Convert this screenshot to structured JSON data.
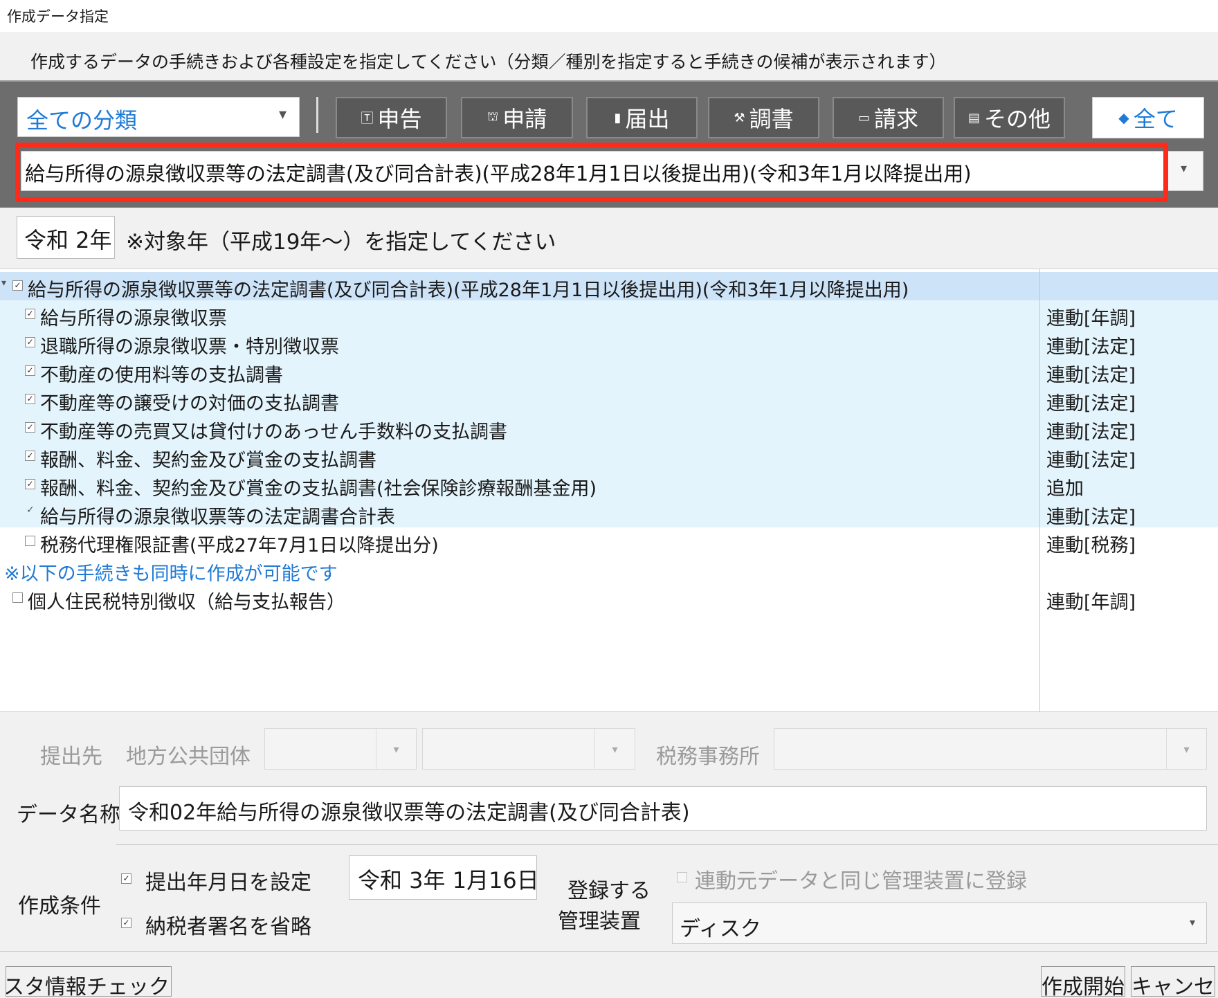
{
  "window": {
    "title": "作成データ指定"
  },
  "instruction": "作成するデータの手続きおよび各種設定を指定してください（分類／種別を指定すると手続きの候補が表示されます）",
  "toolbar": {
    "category_select": "全ての分類",
    "filters": [
      {
        "label": "申告",
        "icon": "tax-icon"
      },
      {
        "label": "申請",
        "icon": "stamp-icon"
      },
      {
        "label": "届出",
        "icon": "mailbox-icon"
      },
      {
        "label": "調書",
        "icon": "gavel-icon"
      },
      {
        "label": "請求",
        "icon": "money-icon"
      },
      {
        "label": "その他",
        "icon": "document-icon"
      }
    ],
    "all_button": {
      "label": "全て",
      "icon": "layers-icon"
    },
    "procedure_select": "給与所得の源泉徴収票等の法定調書(及び同合計表)(平成28年1月1日以後提出用)(令和3年1月以降提出用)"
  },
  "year": {
    "value": "令和 2年",
    "note": "※対象年（平成19年～）を指定してください"
  },
  "tree": {
    "root": {
      "label": "給与所得の源泉徴収票等の法定調書(及び同合計表)(平成28年1月1日以後提出用)(令和3年1月以降提出用)",
      "checked": true
    },
    "children": [
      {
        "label": "給与所得の源泉徴収票",
        "status": "連動[年調]",
        "checked": true
      },
      {
        "label": "退職所得の源泉徴収票・特別徴収票",
        "status": "連動[法定]",
        "checked": true
      },
      {
        "label": "不動産の使用料等の支払調書",
        "status": "連動[法定]",
        "checked": true
      },
      {
        "label": "不動産等の譲受けの対価の支払調書",
        "status": "連動[法定]",
        "checked": true
      },
      {
        "label": "不動産等の売買又は貸付けのあっせん手数料の支払調書",
        "status": "連動[法定]",
        "checked": true
      },
      {
        "label": "報酬、料金、契約金及び賞金の支払調書",
        "status": "連動[法定]",
        "checked": true
      },
      {
        "label": "報酬、料金、契約金及び賞金の支払調書(社会保険診療報酬基金用)",
        "status": "追加",
        "checked": true
      },
      {
        "label": "給与所得の源泉徴収票等の法定調書合計表",
        "status": "連動[法定]",
        "checked": true
      },
      {
        "label": "税務代理権限証書(平成27年7月1日以降提出分)",
        "status": "連動[税務]",
        "checked": false
      }
    ],
    "also_note": "※以下の手続きも同時に作成が可能です",
    "extra": {
      "label": "個人住民税特別徴収（給与支払報告）",
      "status": "連動[年調]",
      "checked": false
    }
  },
  "form": {
    "submit_to_label": "提出先",
    "local_gov_label": "地方公共団体",
    "tax_office_label": "税務事務所",
    "data_name_label": "データ名称",
    "data_name_value": "令和02年給与所得の源泉徴収票等の法定調書(及び同合計表)",
    "conditions_label": "作成条件",
    "cond_submit_date": {
      "label": "提出年月日を設定",
      "checked": true
    },
    "cond_date_value": "令和  3年  1月16日",
    "cond_omit_signature": {
      "label": "納税者署名を省略",
      "checked": true
    },
    "register_label_1": "登録する",
    "register_label_2": "管理装置",
    "same_device": {
      "label": "連動元データと同じ管理装置に登録",
      "checked": false
    },
    "device_select": "ディスク"
  },
  "buttons": {
    "master_check": "会社マスタ情報チェック",
    "start": "作成開始",
    "cancel": "キャンセル"
  },
  "colors": {
    "accent_blue": "#1f7ad6",
    "highlight_red": "#ff2a1a",
    "selected_row": "#cde3f8",
    "child_row": "#e4f4fc"
  }
}
